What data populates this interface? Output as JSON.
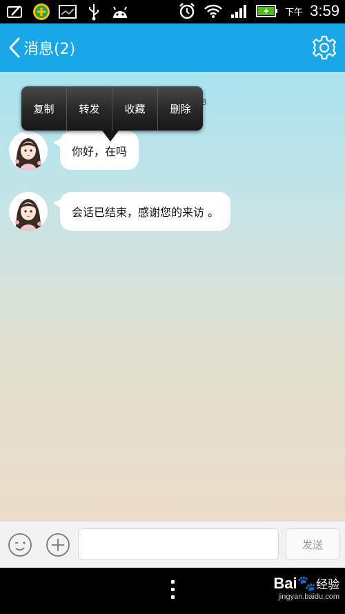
{
  "status_bar": {
    "clock_ampm": "下午",
    "clock_time": "3:59",
    "icons": [
      "notes-app-icon",
      "security-app-icon",
      "picture-icon",
      "usb-icon",
      "android-icon",
      "alarm-icon",
      "wifi-icon",
      "signal-icon",
      "battery-charging-icon"
    ]
  },
  "header": {
    "title": "消息(2)",
    "accent_color": "#18a7e8"
  },
  "popup_menu": {
    "items": [
      "复制",
      "转发",
      "收藏",
      "删除"
    ]
  },
  "timestamp_fragment": "8",
  "messages": [
    {
      "text": "你好，在吗"
    },
    {
      "text": "会话已结束，感谢您的来访 。"
    }
  ],
  "input_bar": {
    "value": "",
    "send_label": "发送"
  },
  "watermark": {
    "logo": "Bai",
    "logo_suffix": "经验",
    "url": "jingyan.baidu.com"
  }
}
